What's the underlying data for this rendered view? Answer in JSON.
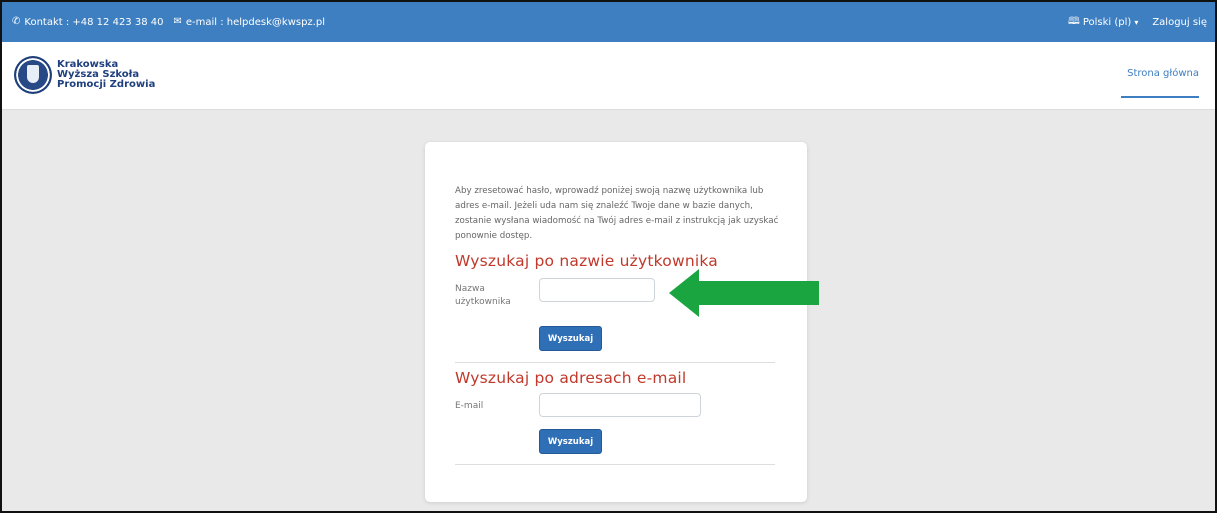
{
  "topbar": {
    "contact_text": "Kontakt : +48 12 423 38 40",
    "email_text": "e-mail : helpdesk@kwspz.pl",
    "language": "Polski (pl)",
    "login": "Zaloguj się",
    "background": "#3e7fc1"
  },
  "logo": {
    "line1": "Krakowska",
    "line2": "Wyższa Szkoła",
    "line3": "Promocji Zdrowia"
  },
  "nav": {
    "home": "Strona główna"
  },
  "card": {
    "intro": "Aby zresetować hasło, wprowadź poniżej swoją nazwę użytkownika lub adres e-mail. Jeżeli uda nam się znaleźć Twoje dane w bazie danych, zostanie wysłana wiadomość na Twój adres e-mail z instrukcją jak uzyskać ponownie dostęp.",
    "username_section": {
      "title": "Wyszukaj po nazwie użytkownika",
      "label": "Nazwa użytkownika",
      "value": "",
      "button": "Wyszukaj"
    },
    "email_section": {
      "title": "Wyszukaj po adresach e-mail",
      "label": "E-mail",
      "value": "",
      "button": "Wyszukaj"
    }
  },
  "annotation": {
    "arrow_color": "#1aa541",
    "direction": "left"
  }
}
